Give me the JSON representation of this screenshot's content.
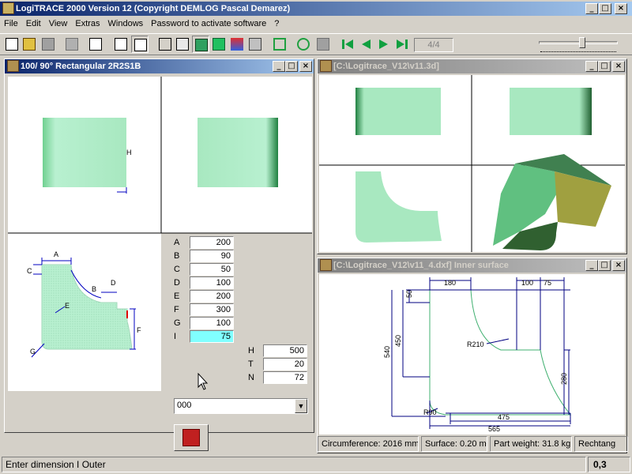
{
  "app": {
    "title": "LogiTRACE 2000  Version 12  (Copyright DEMLOG Pascal Demarez)"
  },
  "menu": [
    "File",
    "Edit",
    "View",
    "Extras",
    "Windows",
    "Password to activate software",
    "?"
  ],
  "toolbar": {
    "page_indicator": "4/4",
    "zoom_level": 0.55
  },
  "windows": {
    "left": {
      "title": "100/ 90° Rectangular 2R2S1B"
    },
    "view3d": {
      "title": "[C:\\Logitrace_V12\\v11.3d]"
    },
    "inner": {
      "title": "[C:\\Logitrace_V12\\v11_4.dxf]  Inner surface"
    }
  },
  "drawing_labels": {
    "A": "A",
    "B": "B",
    "C": "C",
    "D": "D",
    "E": "E",
    "F": "F",
    "G": "G",
    "H": "H",
    "I": "I"
  },
  "fields": [
    {
      "label": "A",
      "value": "200",
      "active": false
    },
    {
      "label": "B",
      "value": "90",
      "active": false
    },
    {
      "label": "C",
      "value": "50",
      "active": false
    },
    {
      "label": "D",
      "value": "100",
      "active": false
    },
    {
      "label": "E",
      "value": "200",
      "active": false
    },
    {
      "label": "F",
      "value": "300",
      "active": false
    },
    {
      "label": "G",
      "value": "100",
      "active": false
    },
    {
      "label": "I",
      "value": "75",
      "active": true
    }
  ],
  "fields2": [
    {
      "label": "H",
      "value": "500"
    },
    {
      "label": "T",
      "value": "20"
    },
    {
      "label": "N",
      "value": "72"
    }
  ],
  "dropdown": {
    "value": "000"
  },
  "dims": {
    "d180": "180",
    "d100": "100",
    "d75": "75",
    "d50": "50",
    "d450": "450",
    "d540": "540",
    "r210": "R210",
    "r90": "R90",
    "d280": "280",
    "d475": "475",
    "d565": "565"
  },
  "info": {
    "circumference": "Circumference: 2016 mm",
    "surface": "Surface: 0.20 m²",
    "weight": "Part weight: 31.8 kg",
    "shape": "Rechtang"
  },
  "status": {
    "message": "Enter dimension I Outer",
    "value": "0,3"
  },
  "colors": {
    "part_green": "#a8e8c0",
    "title_active": "#0a246a",
    "field_active": "#80ffff"
  }
}
